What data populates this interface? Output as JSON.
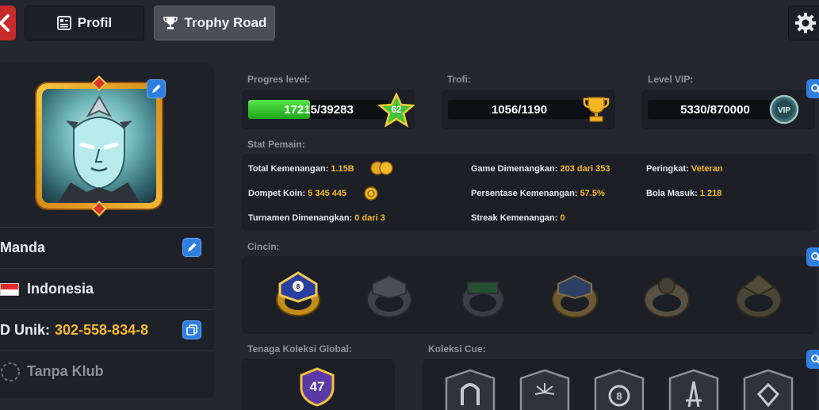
{
  "tabs": [
    {
      "label": "Profil"
    },
    {
      "label": "Trophy Road"
    }
  ],
  "profile": {
    "name": "Manda",
    "country": "Indonesia",
    "unique_id_label": "D Unik:",
    "unique_id": "302-558-834-8",
    "club": "Tanpa Klub"
  },
  "progress": {
    "level_label": "Progres level:",
    "level_text": "17215/39283",
    "level_current": 17215,
    "level_max": 39283,
    "level_number": "62",
    "trophy_label": "Trofi:",
    "trophy_text": "1056/1190",
    "vip_label": "Level VIP:",
    "vip_text": "5330/870000"
  },
  "stats": {
    "title": "Stat Pemain:",
    "items": [
      {
        "label": "Total Kemenangan:",
        "value": "1.15B"
      },
      {
        "label": "Dompet Koin:",
        "value": "5 345 445"
      },
      {
        "label": "Turnamen Dimenangkan:",
        "value": "0 dari 3"
      },
      {
        "label": "Game Dimenangkan:",
        "value": "203 dari 353"
      },
      {
        "label": "Persentase Kemenangan:",
        "value": "57.5%"
      },
      {
        "label": "Streak Kemenangan:",
        "value": "0"
      },
      {
        "label": "Peringkat:",
        "value": "Veteran"
      },
      {
        "label": "Bola Masuk:",
        "value": "1 218"
      }
    ]
  },
  "rings": {
    "title": "Cincin:"
  },
  "collection": {
    "power_title": "Tenaga Koleksi Global:",
    "power_value": "47",
    "cue_title": "Koleksi Cue:"
  },
  "colors": {
    "accent_blue": "#2f7fe0",
    "gold": "#f5b92a",
    "progress_green": "#3cc92f",
    "back_red": "#c62a2a"
  },
  "icons": [
    "back-arrow-icon",
    "profile-card-icon",
    "trophy-icon",
    "gear-icon",
    "pencil-icon",
    "copy-icon",
    "search-icon",
    "star-icon",
    "coin-icon",
    "vip-badge-icon",
    "shield-icon"
  ]
}
